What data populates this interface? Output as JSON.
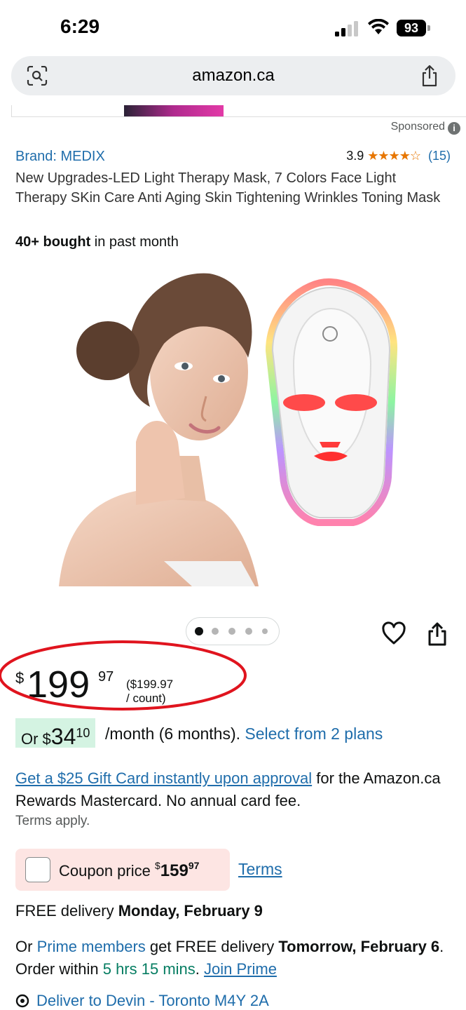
{
  "status": {
    "time": "6:29",
    "battery": "93"
  },
  "browser": {
    "url": "amazon.ca"
  },
  "sponsored": "Sponsored",
  "product": {
    "brand": "Brand: MEDIX",
    "rating_value": "3.9",
    "rating_stars": "★★★★☆",
    "rating_count": "(15)",
    "title": "New Upgrades-LED Light Therapy Mask, 7 Colors Face Light Therapy SKin Care Anti Aging Skin Tightening Wrinkles Toning Mask",
    "bought_bold": "40+ bought",
    "bought_rest": " in past month",
    "rating_fraction": 0.78
  },
  "carousel": {
    "count": 5,
    "active_index": 0
  },
  "price": {
    "symbol": "$",
    "whole": "199",
    "fraction": "97",
    "unit": "($199.97 / count)"
  },
  "monthly": {
    "prefix": "Or $",
    "whole": "34",
    "fraction": "10",
    "rest": "/month (6 months).",
    "select_link": "Select from 2 plans"
  },
  "gift_card": {
    "link": "Get a $25 Gift Card instantly upon approval",
    "rest": " for the Amazon.ca Rewards Mastercard. No annual card fee.",
    "terms": "Terms apply."
  },
  "coupon": {
    "label": "Coupon price ",
    "symbol": "$",
    "whole": "159",
    "fraction": "97",
    "terms": "Terms"
  },
  "delivery": {
    "free_prefix": "FREE delivery ",
    "free_date": "Monday, February 9",
    "prime_or": "Or ",
    "prime_link": "Prime members",
    "prime_mid": " get FREE delivery ",
    "prime_date": "Tomorrow, February 6",
    "order_within": ". Order within ",
    "countdown": "5 hrs 15 mins",
    "period": ". ",
    "join_prime": "Join Prime",
    "deliver_to": "Deliver to Devin - Toronto M4Y 2A"
  },
  "colors": {
    "link": "#1f6dab",
    "star": "#e77600",
    "green": "#067d62",
    "coupon_bg": "#fde5e3",
    "monthly_bg": "#d4f3e2",
    "annotation": "#e0141e"
  }
}
